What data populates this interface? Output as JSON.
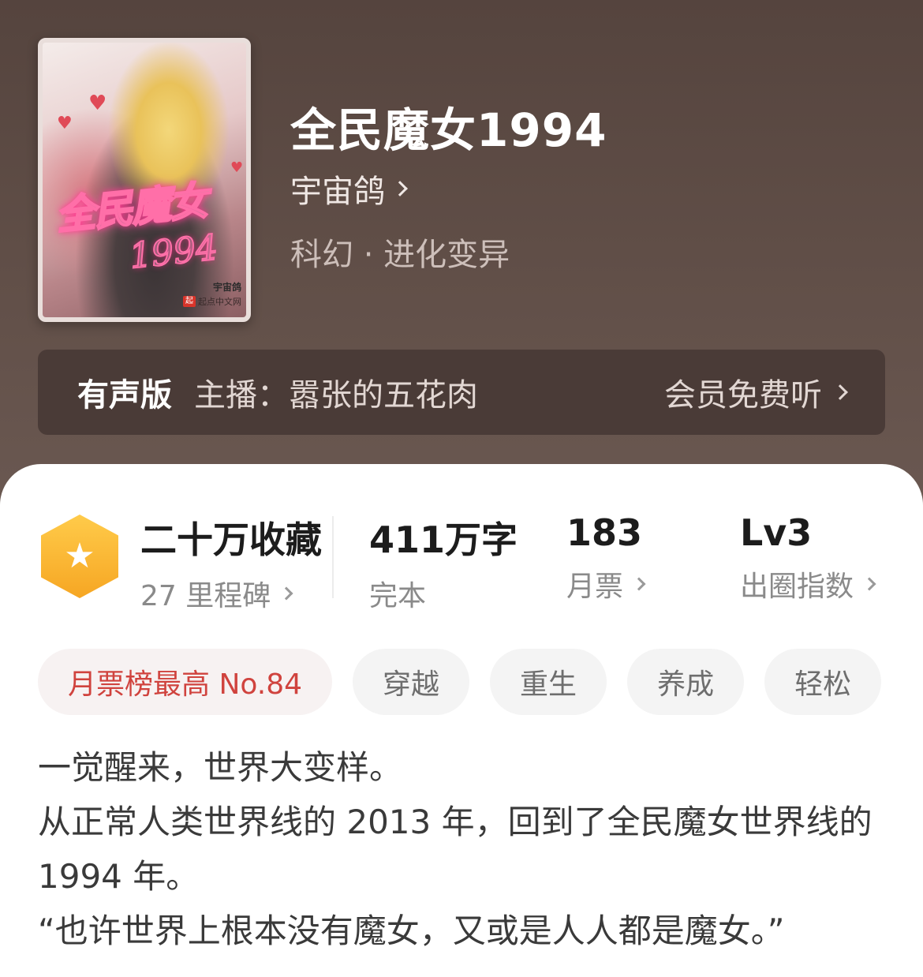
{
  "book": {
    "title": "全民魔女1994",
    "author": "宇宙鸽",
    "genre": "科幻 · 进化变异",
    "cover": {
      "title_text": "全民魔女",
      "title_num": "1994",
      "author": "宇宙鸽",
      "publisher": "起点中文网",
      "logo_char": "起"
    }
  },
  "audio": {
    "label": "有声版",
    "anchor": "主播：嚣张的五花肉",
    "free_listen": "会员免费听"
  },
  "stats": {
    "collect_main": "二十万收藏",
    "collect_sub": "27 里程碑",
    "words_main": "411万字",
    "words_sub": "完本",
    "ticket_main": "183",
    "ticket_sub": "月票",
    "index_main": "Lv3",
    "index_sub": "出圈指数"
  },
  "tags": [
    "月票榜最高 No.84",
    "穿越",
    "重生",
    "养成",
    "轻松"
  ],
  "description": [
    "一觉醒来，世界大变样。",
    "从正常人类世界线的 2013 年，回到了全民魔女世界线的 1994 年。",
    "“也许世界上根本没有魔女，又或是人人都是魔女。”"
  ],
  "colors": {
    "hero_bg": "#5e4d47",
    "accent_rank": "#d0433e",
    "badge": "#f6a623"
  },
  "icons": {
    "badge": "star-icon",
    "chevron": "chevron-right-icon"
  }
}
